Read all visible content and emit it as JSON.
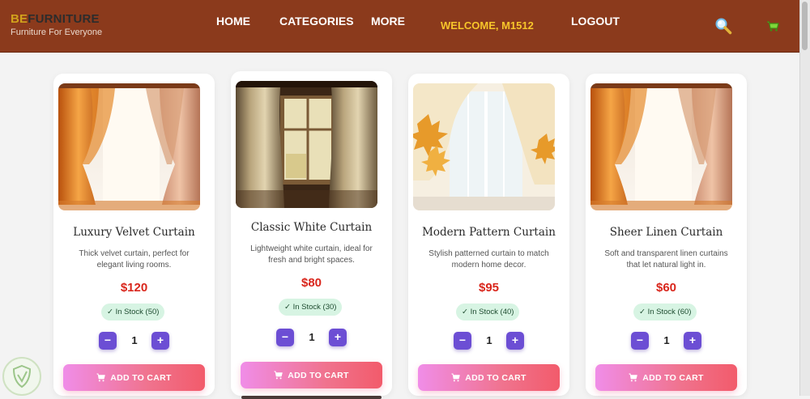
{
  "header": {
    "brand_prefix": "BE",
    "brand_suffix": "FURNITURE",
    "tagline": "Furniture For Everyone",
    "nav": [
      "HOME",
      "CATEGORIES",
      "MORE"
    ],
    "welcome": "WELCOME, M1512",
    "logout": "LOGOUT",
    "colors": {
      "bar": "#8b3a1c",
      "welcome": "#f7c52a"
    }
  },
  "products": [
    {
      "name": "Luxury Velvet Curtain",
      "description": "Thick velvet curtain, perfect for elegant living rooms.",
      "price": "$120",
      "stock": "✓ In Stock (50)",
      "qty": "1",
      "add_to_cart": "ADD TO CART"
    },
    {
      "name": "Classic White Curtain",
      "description": "Lightweight white curtain, ideal for fresh and bright spaces.",
      "price": "$80",
      "stock": "✓ In Stock (30)",
      "qty": "1",
      "add_to_cart": "ADD TO CART"
    },
    {
      "name": "Modern Pattern Curtain",
      "description": "Stylish patterned curtain to match modern home decor.",
      "price": "$95",
      "stock": "✓ In Stock (40)",
      "qty": "1",
      "add_to_cart": "ADD TO CART"
    },
    {
      "name": "Sheer Linen Curtain",
      "description": "Soft and transparent linen curtains that let natural light in.",
      "price": "$60",
      "stock": "✓ In Stock (60)",
      "qty": "1",
      "add_to_cart": "ADD TO CART"
    }
  ],
  "qty_controls": {
    "minus": "−",
    "plus": "+"
  },
  "icons": [
    "search-icon",
    "cart-icon",
    "shield-watermark-icon"
  ]
}
